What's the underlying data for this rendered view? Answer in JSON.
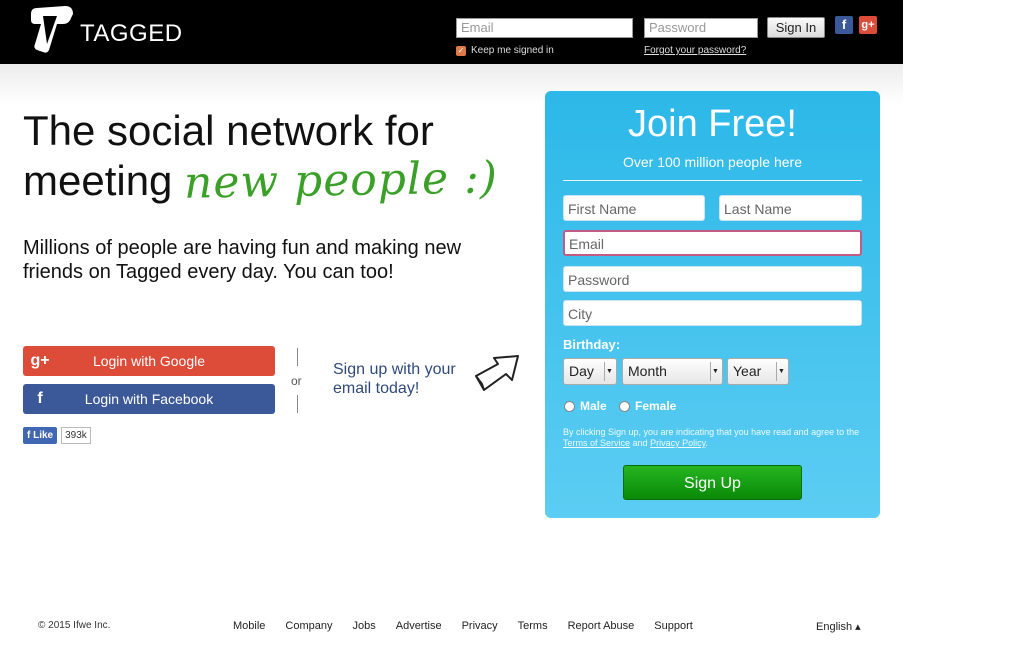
{
  "header": {
    "logo_text": "TAGGED",
    "email_placeholder": "Email",
    "password_placeholder": "Password",
    "signin_label": "Sign In",
    "keep_signed_in": "Keep me signed in",
    "forgot_password": "Forgot your password?",
    "facebook_icon": "f",
    "google_icon": "g+"
  },
  "hero": {
    "headline_line1": "The social network for",
    "headline_line2": "meeting",
    "headline_highlight": "new people :)",
    "subline": "Millions of people are having fun and making new friends on Tagged every day. You can too!"
  },
  "social": {
    "google_label": "Login with Google",
    "facebook_label": "Login with Facebook",
    "google_icon": "g+",
    "facebook_icon": "f",
    "like_label": "Like",
    "like_count": "393k",
    "or_text": "or",
    "email_cta": "Sign up with your email today!"
  },
  "join": {
    "title": "Join Free!",
    "subtitle": "Over 100 million people here",
    "first_name_placeholder": "First Name",
    "last_name_placeholder": "Last Name",
    "email_placeholder": "Email",
    "password_placeholder": "Password",
    "city_placeholder": "City",
    "birthday_label": "Birthday:",
    "day_label": "Day",
    "month_label": "Month",
    "year_label": "Year",
    "male_label": "Male",
    "female_label": "Female",
    "terms_prefix": "By clicking Sign up, you are indicating that you have read and agree to the",
    "terms_of_service": "Terms of Service",
    "terms_and": "and",
    "privacy_policy": "Privacy Policy",
    "terms_suffix": ".",
    "signup_label": "Sign Up"
  },
  "footer": {
    "copyright": "© 2015 Ifwe Inc.",
    "links": [
      "Mobile",
      "Company",
      "Jobs",
      "Advertise",
      "Privacy",
      "Terms",
      "Report Abuse",
      "Support"
    ],
    "language": "English ▴"
  },
  "colors": {
    "topbar": "#000000",
    "panel": "#2cb8e8",
    "google": "#dd4b39",
    "facebook": "#3b5998",
    "signup": "#1aa017",
    "handwritten": "#3aa028"
  }
}
